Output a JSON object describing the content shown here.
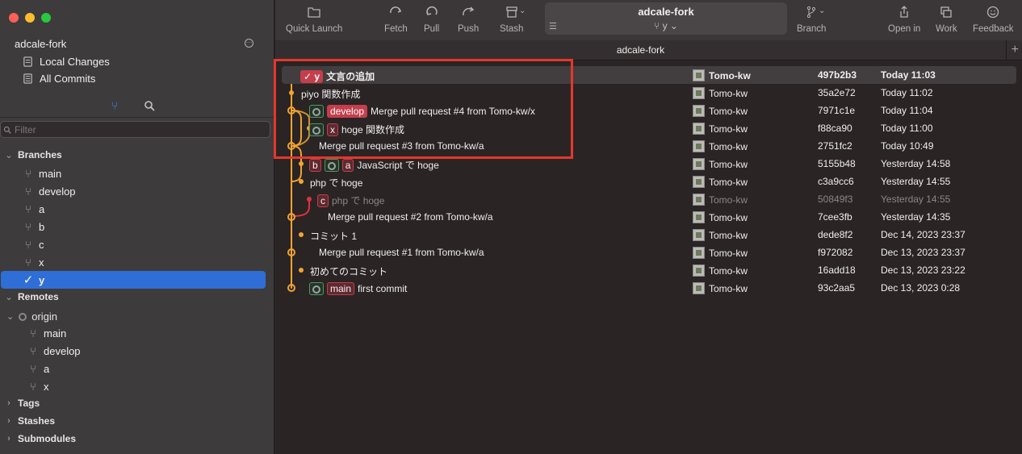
{
  "sidebar": {
    "repo_name": "adcale-fork",
    "nav": [
      {
        "label": "Local Changes"
      },
      {
        "label": "All Commits"
      }
    ],
    "filter_placeholder": "Filter",
    "sections": {
      "branches": "Branches",
      "remotes": "Remotes",
      "tags": "Tags",
      "stashes": "Stashes",
      "submodules": "Submodules"
    },
    "branches": [
      "main",
      "develop",
      "a",
      "b",
      "c",
      "x",
      "y"
    ],
    "selected_branch": "y",
    "remote_name": "origin",
    "remote_branches": [
      "main",
      "develop",
      "a",
      "x"
    ]
  },
  "toolbar": {
    "quick_launch": "Quick Launch",
    "fetch": "Fetch",
    "pull": "Pull",
    "push": "Push",
    "stash": "Stash",
    "repo_title": "adcale-fork",
    "current_branch": "y",
    "branch": "Branch",
    "open_in": "Open in",
    "work": "Work",
    "feedback": "Feedback"
  },
  "repo_tab": "adcale-fork",
  "commits": [
    {
      "message": "文言の追加",
      "author": "Tomo-kw",
      "hash": "497b2b3",
      "date": "Today 11:03"
    },
    {
      "message": "piyo 関数作成",
      "author": "Tomo-kw",
      "hash": "35a2e72",
      "date": "Today 11:02"
    },
    {
      "message": "Merge pull request #4 from Tomo-kw/x",
      "author": "Tomo-kw",
      "hash": "7971c1e",
      "date": "Today 11:04"
    },
    {
      "message": "hoge 関数作成",
      "author": "Tomo-kw",
      "hash": "f88ca90",
      "date": "Today 11:00"
    },
    {
      "message": "Merge pull request #3 from Tomo-kw/a",
      "author": "Tomo-kw",
      "hash": "2751fc2",
      "date": "Today 10:49"
    },
    {
      "message": "JavaScript で hoge",
      "author": "Tomo-kw",
      "hash": "5155b48",
      "date": "Yesterday 14:58"
    },
    {
      "message": "php で hoge",
      "author": "Tomo-kw",
      "hash": "c3a9cc6",
      "date": "Yesterday 14:55"
    },
    {
      "message": "php で hoge",
      "author": "Tomo-kw",
      "hash": "50849f3",
      "date": "Yesterday 14:55"
    },
    {
      "message": "Merge pull request #2 from Tomo-kw/a",
      "author": "Tomo-kw",
      "hash": "7cee3fb",
      "date": "Yesterday 14:35"
    },
    {
      "message": "コミット 1",
      "author": "Tomo-kw",
      "hash": "dede8f2",
      "date": "Dec 14, 2023 23:37"
    },
    {
      "message": "Merge pull request #1 from Tomo-kw/a",
      "author": "Tomo-kw",
      "hash": "f972082",
      "date": "Dec 13, 2023 23:37"
    },
    {
      "message": "初めてのコミット",
      "author": "Tomo-kw",
      "hash": "16add18",
      "date": "Dec 13, 2023 23:22"
    },
    {
      "message": "first commit",
      "author": "Tomo-kw",
      "hash": "93c2aa5",
      "date": "Dec 13, 2023 0:28"
    }
  ],
  "refs": {
    "row0": [
      "y"
    ],
    "row2": [
      "develop"
    ],
    "row3": [
      "x"
    ],
    "row5": [
      "b",
      "a"
    ],
    "row7": [
      "c"
    ],
    "row12": [
      "main"
    ]
  },
  "colors": {
    "graph_main": "#f2a431",
    "graph_branch": "#e0333d",
    "highlight": "#e5372c",
    "selection": "#2f6ed6"
  }
}
